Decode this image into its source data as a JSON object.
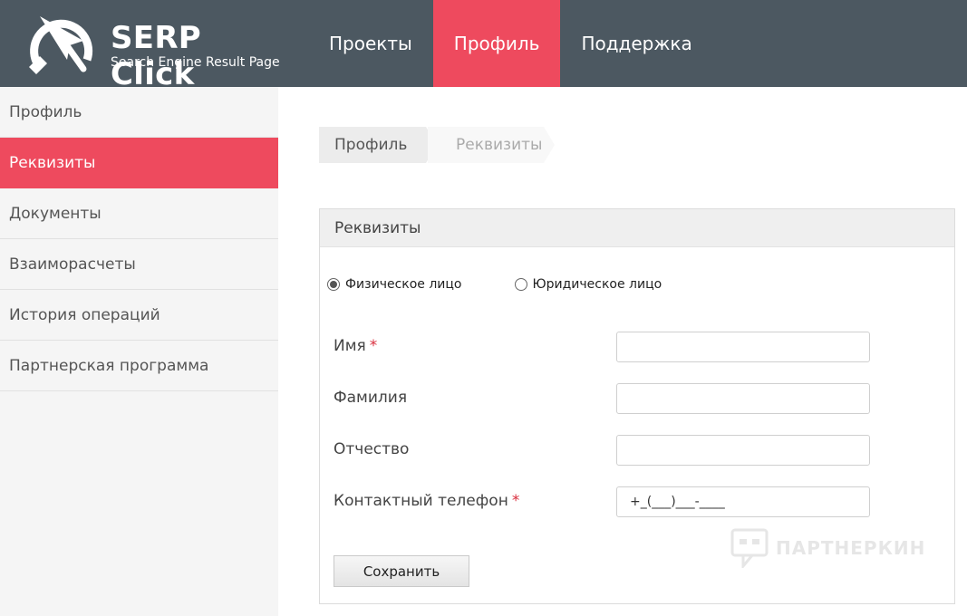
{
  "brand": {
    "title": "SERP Click",
    "subtitle": "Search Engine Result Page"
  },
  "nav": {
    "items": [
      {
        "label": "Проекты"
      },
      {
        "label": "Профиль"
      },
      {
        "label": "Поддержка"
      }
    ],
    "active_label": "Профиль"
  },
  "sidebar": {
    "items": [
      {
        "label": "Профиль"
      },
      {
        "label": "Реквизиты"
      },
      {
        "label": "Документы"
      },
      {
        "label": "Взаиморасчеты"
      },
      {
        "label": "История операций"
      },
      {
        "label": "Партнерская программа"
      }
    ],
    "active_label": "Реквизиты"
  },
  "breadcrumb": {
    "items": [
      {
        "label": "Профиль"
      },
      {
        "label": "Реквизиты"
      }
    ]
  },
  "panel": {
    "title": "Реквизиты",
    "radios": [
      {
        "label": "Физическое лицо",
        "checked": true
      },
      {
        "label": "Юридическое лицо",
        "checked": false
      }
    ],
    "fields": [
      {
        "label": "Имя",
        "required": "*",
        "value": ""
      },
      {
        "label": "Фамилия",
        "required": "",
        "value": ""
      },
      {
        "label": "Отчество",
        "required": "",
        "value": ""
      },
      {
        "label": "Контактный телефон",
        "required": "*",
        "value": "+_(___)___-____"
      }
    ],
    "save_label": "Сохранить"
  },
  "watermark": {
    "text": "ПАРТНЕРКИН"
  },
  "colors": {
    "header_bg": "#4c5861",
    "accent": "#ee4a5e",
    "required": "#d92e3d"
  }
}
